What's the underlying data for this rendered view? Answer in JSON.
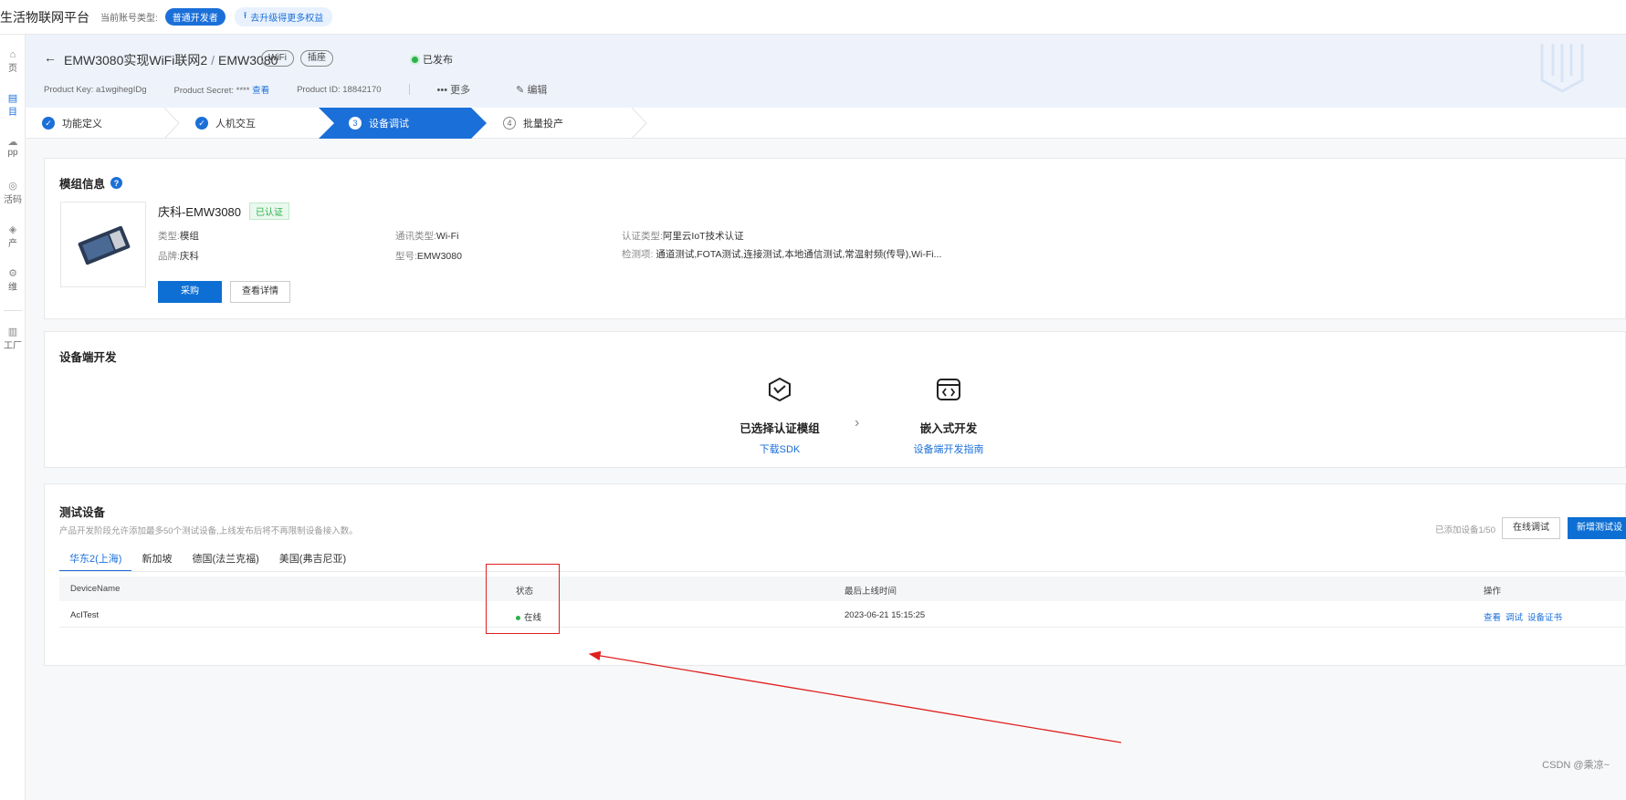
{
  "topbar": {
    "platform_title": "生活物联网平台",
    "account_type_label": "当前账号类型:",
    "account_type_badge": "普通开发者",
    "upgrade_label": "去升级得更多权益"
  },
  "leftnav": {
    "items": [
      {
        "label": "页",
        "icon": "home-icon"
      },
      {
        "label": "目",
        "icon": "project-icon"
      },
      {
        "label": "pp",
        "icon": "app-icon"
      },
      {
        "label": "活码",
        "icon": "activation-code-icon"
      },
      {
        "label": "产",
        "icon": "production-icon"
      },
      {
        "label": "维",
        "icon": "operations-icon"
      },
      {
        "label": "工厂",
        "icon": "factory-icon"
      }
    ]
  },
  "header": {
    "product_path": "EMW3080实现WiFi联网2",
    "product_name": "EMW3080",
    "tag_wifi": "WiFi",
    "tag_socket": "插座",
    "publish_status": "已发布",
    "product_key_label": "Product Key:",
    "product_key": "a1wgihegIDg",
    "product_secret_label": "Product Secret:",
    "product_secret": "****",
    "view_link": "查看",
    "product_id_label": "Product ID:",
    "product_id": "18842170",
    "more": "更多",
    "edit": "编辑"
  },
  "steps": [
    {
      "label": "功能定义",
      "state": "done"
    },
    {
      "label": "人机交互",
      "state": "done"
    },
    {
      "label": "设备调试",
      "state": "active",
      "num": "3"
    },
    {
      "label": "批量投产",
      "state": "todo",
      "num": "4"
    }
  ],
  "module_card": {
    "title": "模组信息",
    "name": "庆科-EMW3080",
    "verified_badge": "已认证",
    "type_label": "类型:",
    "type_value": "模组",
    "brand_label": "品牌:",
    "brand_value": "庆科",
    "comm_label": "通讯类型:",
    "comm_value": "Wi-Fi",
    "model_label": "型号:",
    "model_value": "EMW3080",
    "cert_label": "认证类型:",
    "cert_value": "阿里云IoT技术认证",
    "test_label": "检测项:",
    "test_value": "通道测试,FOTA测试,连接测试,本地通信测试,常温射频(传导),Wi-Fi...",
    "buy_button": "采购",
    "details_button": "查看详情"
  },
  "devdev_card": {
    "title": "设备端开发",
    "step1_title": "已选择认证模组",
    "step1_link": "下载SDK",
    "step2_title": "嵌入式开发",
    "step2_link": "设备端开发指南"
  },
  "test_card": {
    "title": "测试设备",
    "description": "产品开发阶段允许添加最多50个测试设备,上线发布后将不再限制设备接入数。",
    "added_count": "已添加设备1/50",
    "online_debug_button": "在线调试",
    "add_device_button": "新增测试设",
    "tabs": [
      "华东2(上海)",
      "新加坡",
      "德国(法兰克福)",
      "美国(弗吉尼亚)"
    ],
    "active_tab": "华东2(上海)",
    "columns": [
      "DeviceName",
      "状态",
      "最后上线时间",
      "操作"
    ],
    "rows": [
      {
        "device_name": "AcITest",
        "status": "在线",
        "last_online": "2023-06-21 15:15:25",
        "ops": [
          "查看",
          "调试",
          "设备证书"
        ]
      }
    ]
  },
  "watermark": "CSDN @乘凉~",
  "colors": {
    "primary": "#1b6fd8",
    "online": "#2bb24c",
    "annotation_red": "#e02020"
  }
}
